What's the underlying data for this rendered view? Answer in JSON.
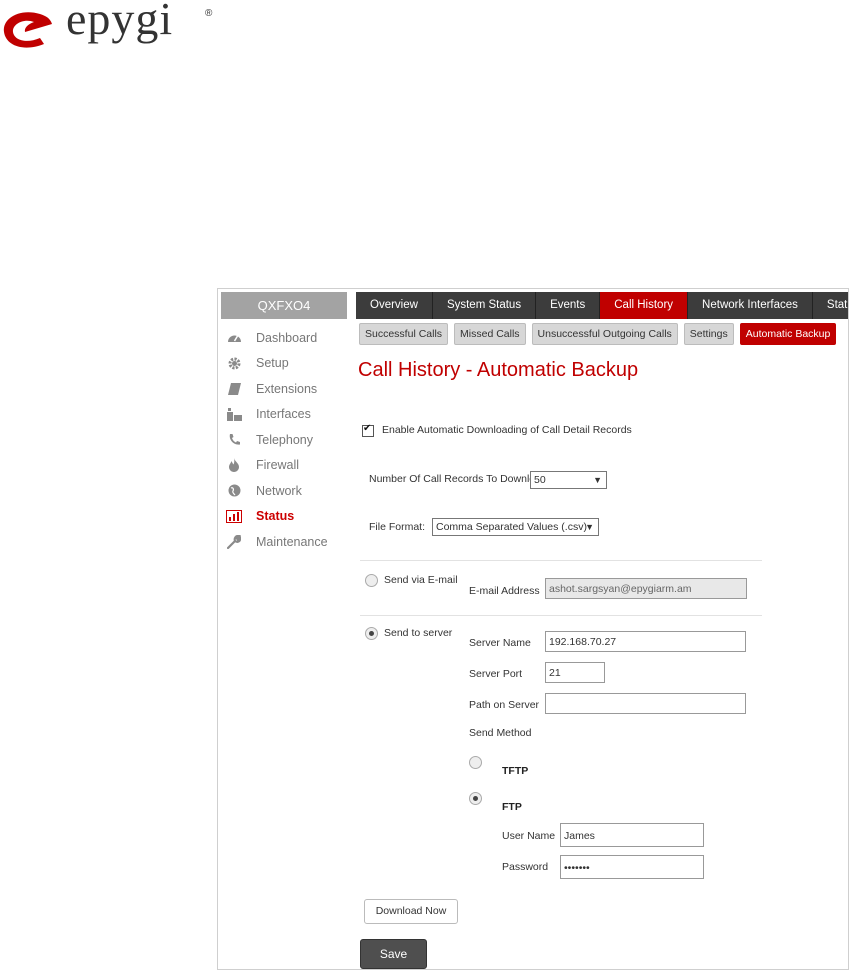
{
  "logo": {
    "brand": "epygi",
    "reg": "®"
  },
  "device": {
    "name": "QXFXO4"
  },
  "sidebar": {
    "items": [
      {
        "label": "Dashboard",
        "icon": "dashboard-icon"
      },
      {
        "label": "Setup",
        "icon": "gear-icon"
      },
      {
        "label": "Extensions",
        "icon": "book-icon"
      },
      {
        "label": "Interfaces",
        "icon": "network-ports-icon"
      },
      {
        "label": "Telephony",
        "icon": "phone-icon"
      },
      {
        "label": "Firewall",
        "icon": "flame-icon"
      },
      {
        "label": "Network",
        "icon": "globe-icon"
      },
      {
        "label": "Status",
        "icon": "bar-chart-icon",
        "active": true
      },
      {
        "label": "Maintenance",
        "icon": "wrench-icon"
      }
    ]
  },
  "top_tabs": [
    {
      "label": "Overview"
    },
    {
      "label": "System Status"
    },
    {
      "label": "Events"
    },
    {
      "label": "Call History",
      "active": true
    },
    {
      "label": "Network Interfaces"
    },
    {
      "label": "Statistics"
    }
  ],
  "sub_tabs": [
    {
      "label": "Successful Calls"
    },
    {
      "label": "Missed Calls"
    },
    {
      "label": "Unsuccessful Outgoing Calls"
    },
    {
      "label": "Settings"
    },
    {
      "label": "Automatic Backup",
      "active": true
    }
  ],
  "page_title": "Call History - Automatic Backup",
  "form": {
    "enable_label": "Enable Automatic Downloading of Call Detail Records",
    "enable_checked": true,
    "records_label": "Number Of Call Records To Download:",
    "records_value": "50",
    "format_label": "File Format:",
    "format_value": "Comma Separated Values (.csv)",
    "email_radio_label": "Send via E-mail",
    "email_label": "E-mail Address",
    "email_value": "ashot.sargsyan@epygiarm.am",
    "server_radio_label": "Send to server",
    "server_name_label": "Server Name",
    "server_name_value": "192.168.70.27",
    "server_port_label": "Server Port",
    "server_port_value": "21",
    "path_label": "Path on Server",
    "path_value": "",
    "send_method_label": "Send Method",
    "tftp_label": "TFTP",
    "ftp_label": "FTP",
    "user_label": "User Name",
    "user_value": "James",
    "password_label": "Password",
    "password_value": "•••••••",
    "download_button": "Download Now",
    "save_button": "Save"
  },
  "colors": {
    "accent": "#c00000",
    "topbar": "#3c3c3c",
    "device_bg": "#a3a3a3"
  }
}
